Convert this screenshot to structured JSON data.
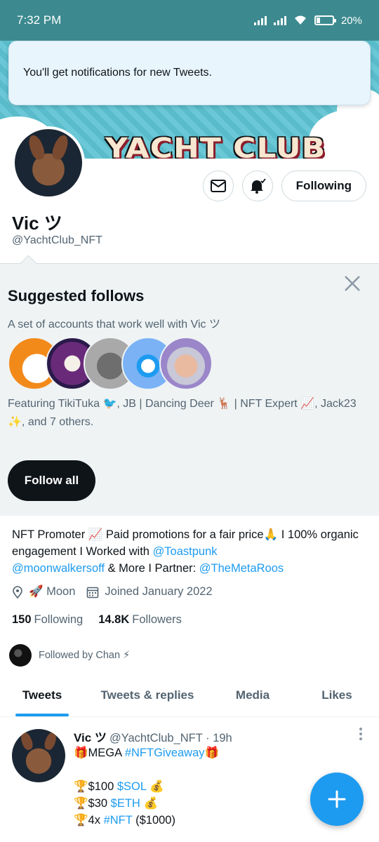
{
  "status_bar": {
    "time": "7:32 PM",
    "battery": "20%"
  },
  "toast": {
    "message": "You'll get notifications for new Tweets."
  },
  "banner": {
    "text": "YACHT CLUB"
  },
  "profile": {
    "name": "Vic ツ",
    "handle": "@YachtClub_NFT",
    "following_button": "Following",
    "bio_parts": {
      "text1": "NFT Promoter 📈 Paid promotions for a fair price🙏 I 100% organic engagement I Worked with ",
      "link1": "@Toastpunk",
      "link2": "@moonwalkersoff",
      "text2": " & More I Partner: ",
      "link3": "@TheMetaRoos"
    },
    "location": "🚀 Moon",
    "joined": "Joined January 2022",
    "following_count": "150",
    "following_label": "Following",
    "followers_count": "14.8K",
    "followers_label": "Followers",
    "followed_by": "Followed by Chan ⚡"
  },
  "suggested": {
    "title": "Suggested follows",
    "subtitle": "A set of accounts that work well with Vic ツ",
    "featuring": "Featuring TikiTuka 🐦, JB | Dancing Deer 🦌 | NFT Expert 📈, Jack23 ✨, and 7 others.",
    "follow_all": "Follow all"
  },
  "tabs": [
    {
      "label": "Tweets",
      "active": true
    },
    {
      "label": "Tweets & replies",
      "active": false
    },
    {
      "label": "Media",
      "active": false
    },
    {
      "label": "Likes",
      "active": false
    }
  ],
  "tweet": {
    "name": "Vic ツ",
    "handle_time": "@YachtClub_NFT · 19h",
    "line1_pre": "🎁MEGA ",
    "line1_tag": "#NFTGiveaway",
    "line1_post": "🎁",
    "line2_pre": "🏆$100 ",
    "line2_tag": "$SOL",
    "line2_post": " 💰",
    "line3_pre": "🏆$30 ",
    "line3_tag": "$ETH",
    "line3_post": " 💰",
    "line4_pre": "🏆4x ",
    "line4_tag": "#NFT",
    "line4_post": " ($1000)"
  },
  "colors": {
    "accent": "#1d9bf0",
    "banner": "#5ec3d3",
    "status_bar": "#3c8a8f",
    "suggest_bg": "#eff3f4"
  }
}
